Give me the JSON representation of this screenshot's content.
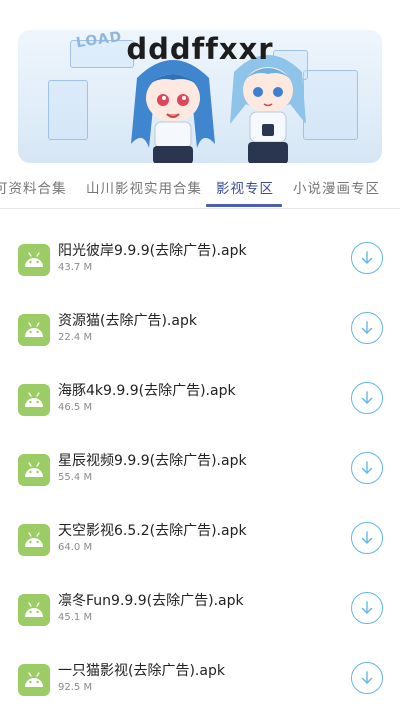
{
  "banner": {
    "title": "dddffxxr",
    "sign_text": "LOAD"
  },
  "tabs": [
    {
      "label": "可资料合集"
    },
    {
      "label": "山川影视实用合集"
    },
    {
      "label": "影视专区",
      "active": true
    },
    {
      "label": "小说漫画专区"
    }
  ],
  "files": [
    {
      "name": "阳光彼岸9.9.9(去除广告).apk",
      "size": "43.7 M"
    },
    {
      "name": "资源猫(去除广告).apk",
      "size": "22.4 M"
    },
    {
      "name": "海豚4k9.9.9(去除广告).apk",
      "size": "46.5 M"
    },
    {
      "name": "星辰视频9.9.9(去除广告).apk",
      "size": "55.4 M"
    },
    {
      "name": "天空影视6.5.2(去除广告).apk",
      "size": "64.0 M"
    },
    {
      "name": "凛冬Fun9.9.9(去除广告).apk",
      "size": "45.1 M"
    },
    {
      "name": "一只猫影视(去除广告).apk",
      "size": "92.5 M"
    }
  ],
  "icons": {
    "file": "android-icon",
    "action": "download-icon"
  },
  "colors": {
    "accent": "#4a5fb0",
    "android": "#9ccc65",
    "download": "#60b8ea"
  }
}
